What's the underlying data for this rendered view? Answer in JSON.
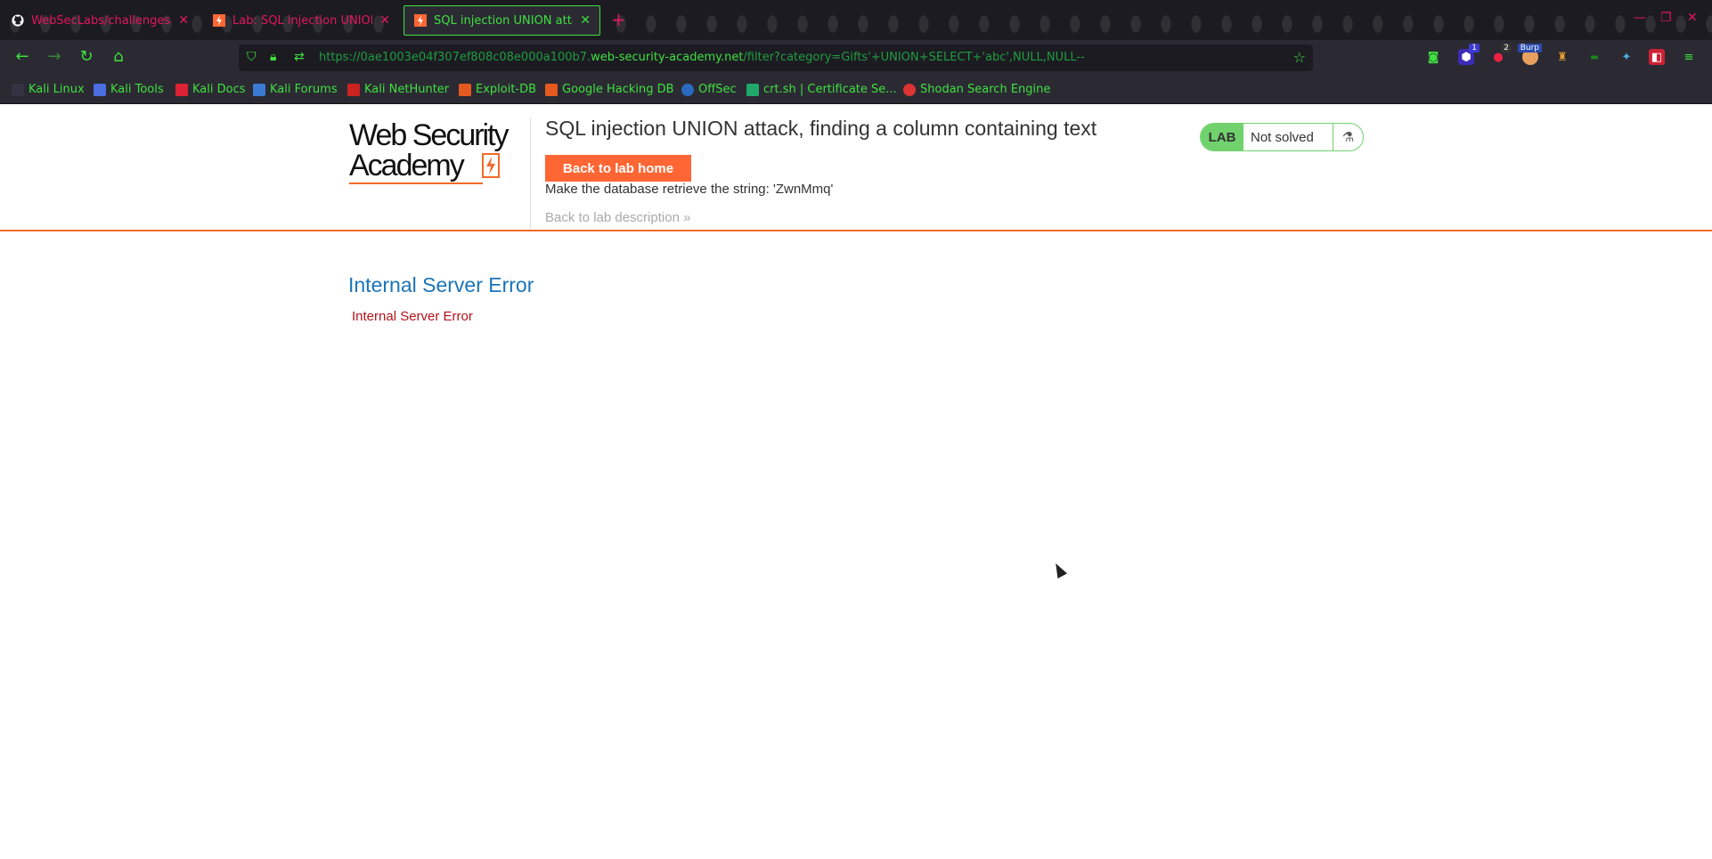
{
  "tabs": [
    {
      "title": "WebSecLabs/challenges/sq",
      "icon": "github-icon"
    },
    {
      "title": "Lab: SQL injection UNION",
      "icon": "portswigger-icon"
    },
    {
      "title": "SQL injection UNION attack",
      "icon": "portswigger-icon"
    }
  ],
  "address_bar": {
    "url_prefix": "https://0ae1003e04f307ef808c08e000a100b7.",
    "url_host": "web-security-academy.net",
    "url_path": "/filter?category=Gifts'+UNION+SELECT+'abc',NULL,NULL--"
  },
  "extensions": {
    "badge_1": "1",
    "badge_2": "2",
    "badge_3": "Burp"
  },
  "bookmarks": [
    "Kali Linux",
    "Kali Tools",
    "Kali Docs",
    "Kali Forums",
    "Kali NetHunter",
    "Exploit-DB",
    "Google Hacking DB",
    "OffSec",
    "crt.sh | Certificate Se...",
    "Shodan Search Engine"
  ],
  "logo": {
    "line1": "Web Security",
    "line2": "Academy"
  },
  "lab": {
    "title": "SQL injection UNION attack, finding a column containing text",
    "back_home": "Back to lab home",
    "objective": "Make the database retrieve the string: 'ZwnMmq'",
    "back_description": "Back to lab description",
    "status_label": "LAB",
    "status": "Not solved"
  },
  "error": {
    "heading": "Internal Server Error",
    "message": "Internal Server Error"
  },
  "colors": {
    "accent": "#ff6633",
    "lab_green": "#70d16d",
    "error_red": "#b5121b",
    "link_blue": "#1a74b8",
    "theme_green": "#3fe03f"
  }
}
